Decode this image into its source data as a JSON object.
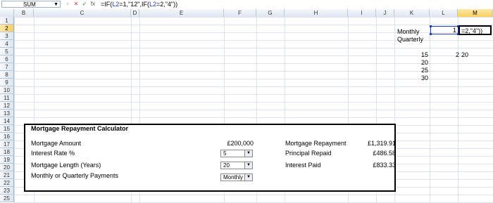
{
  "formula_bar": {
    "name_box": "SUM",
    "fx": "fx",
    "formula_parts": [
      "=IF(",
      "L2",
      "=1,\"12\",IF(",
      "L2",
      "=2,\"4\"))"
    ]
  },
  "columns": [
    "B",
    "C",
    "D",
    "E",
    "F",
    "G",
    "H",
    "I",
    "J",
    "K",
    "L",
    "M"
  ],
  "rows": [
    "1",
    "2",
    "3",
    "4",
    "5",
    "6",
    "7",
    "8",
    "9",
    "10",
    "11",
    "12",
    "13",
    "14",
    "15",
    "16",
    "17",
    "18",
    "19",
    "20",
    "21",
    "22",
    "23",
    "25",
    "26"
  ],
  "side_list": {
    "monthly": "Monthly",
    "quarterly": "Quarterly",
    "values": [
      "15",
      "20",
      "25",
      "30"
    ],
    "l2_value": "1",
    "l5_value": "2",
    "m5_value": "20",
    "m2_editing": "=2,\"4\"))"
  },
  "calculator": {
    "title": "Mortgage Repayment Calculator",
    "labels": [
      "Mortgage Amount",
      "Interest Rate %",
      "Mortgage Length (Years)",
      "Monthly or Quarterly Payments"
    ],
    "mortgage_amount": "£200,000",
    "interest_rate": "5",
    "length_years": "20",
    "payment_freq": "Monthly",
    "results": [
      {
        "label": "Mortgage Repayment",
        "value": "£1,319.91"
      },
      {
        "label": "Principal Repaid",
        "value": "£486.58"
      },
      {
        "label": "Interest Paid",
        "value": "£833.33"
      }
    ]
  }
}
